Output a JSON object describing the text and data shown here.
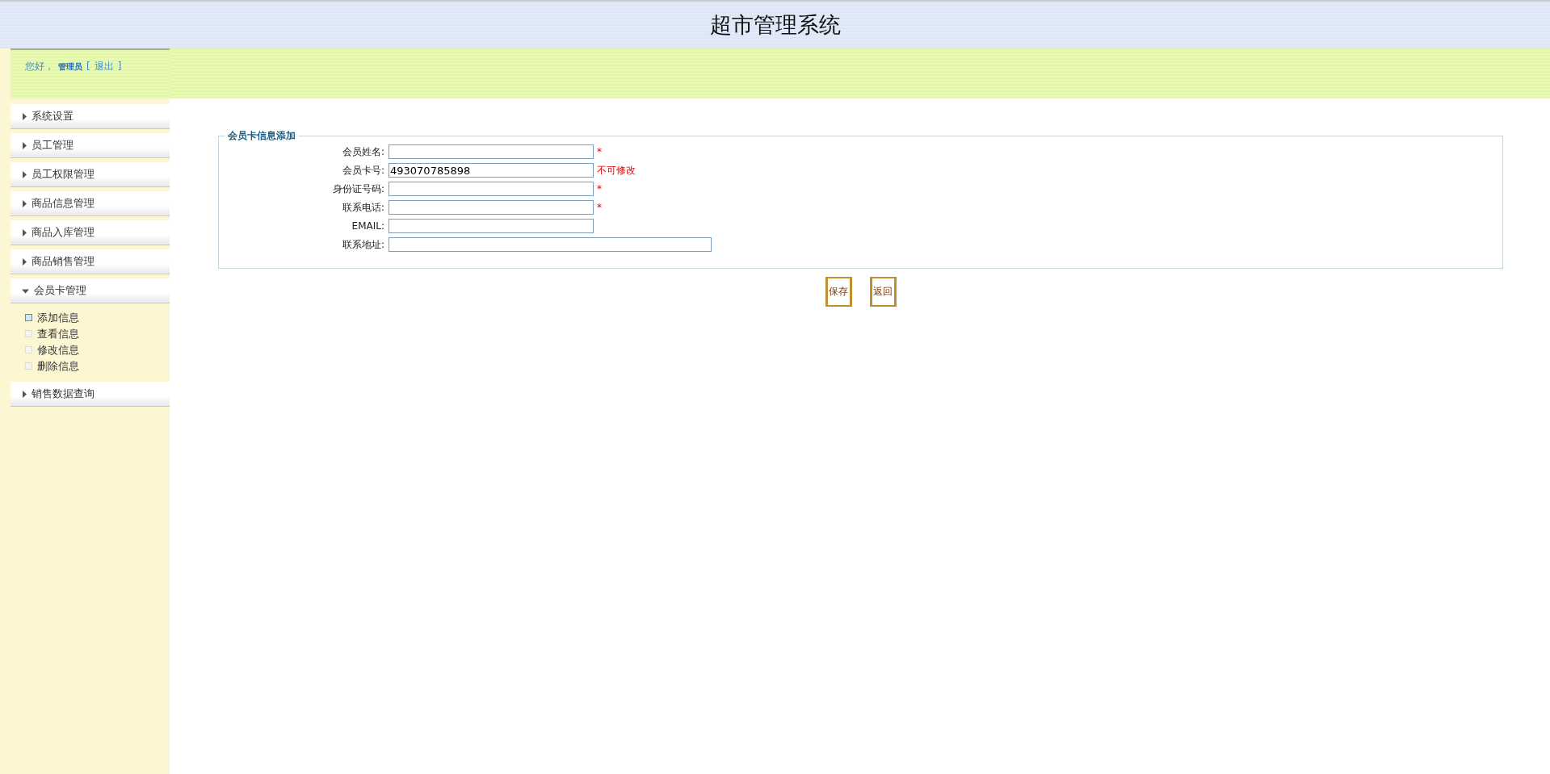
{
  "header": {
    "title": "超市管理系统"
  },
  "user": {
    "greeting": "您好，",
    "name": "管理员",
    "bracket_open": "[",
    "logout": "退出",
    "bracket_close": "]"
  },
  "menu": [
    {
      "label": "系统设置",
      "expanded": false
    },
    {
      "label": "员工管理",
      "expanded": false
    },
    {
      "label": "员工权限管理",
      "expanded": false
    },
    {
      "label": "商品信息管理",
      "expanded": false
    },
    {
      "label": "商品入库管理",
      "expanded": false
    },
    {
      "label": "商品销售管理",
      "expanded": false
    },
    {
      "label": "会员卡管理",
      "expanded": true,
      "children": [
        {
          "label": "添加信息",
          "selected": true
        },
        {
          "label": "查看信息",
          "selected": false
        },
        {
          "label": "修改信息",
          "selected": false
        },
        {
          "label": "删除信息",
          "selected": false
        }
      ]
    },
    {
      "label": "销售数据查询",
      "expanded": false
    }
  ],
  "form": {
    "legend": "会员卡信息添加",
    "fields": [
      {
        "label": "会员姓名:",
        "kind": "short",
        "note": "*"
      },
      {
        "label": "会员卡号:",
        "value": "493070785898",
        "kind": "short",
        "note": "不可修改"
      },
      {
        "label": "身份证号码:",
        "kind": "short",
        "note": "*"
      },
      {
        "label": "联系电话:",
        "kind": "short",
        "note": "*"
      },
      {
        "label": "EMAIL:",
        "kind": "short"
      },
      {
        "label": "联系地址:",
        "kind": "long"
      }
    ]
  },
  "buttons": [
    "保存",
    "返回"
  ]
}
